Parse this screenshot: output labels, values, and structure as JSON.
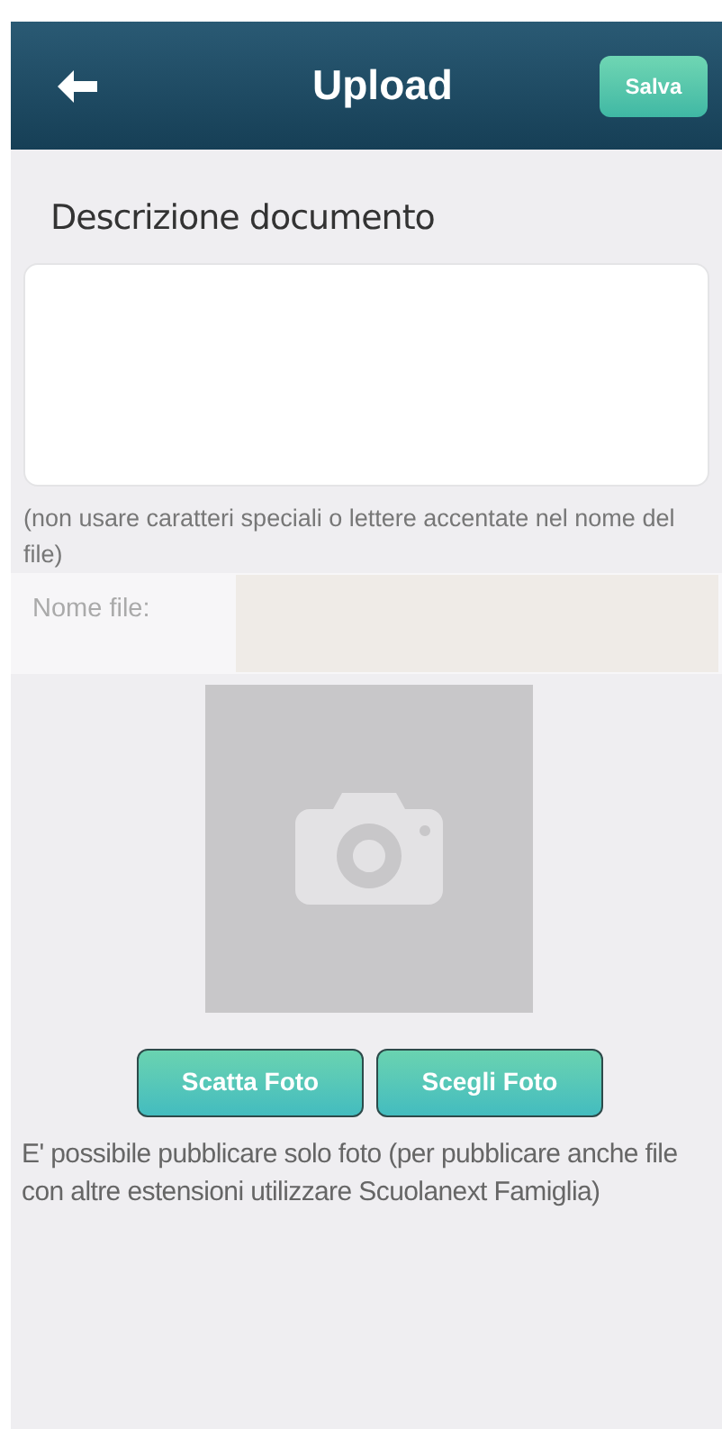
{
  "header": {
    "title": "Upload",
    "save_button": "Salva"
  },
  "description": {
    "label": "Descrizione documento",
    "hint": "(non usare caratteri speciali o lettere accentate nel nome del file)"
  },
  "file_name": {
    "label": "Nome file:"
  },
  "photo_buttons": [
    "Scatta Foto",
    "Scegli Foto"
  ],
  "note": "E' possibile pubblicare solo foto (per pubblicare anche file con altre estensioni utilizzare Scuolanext Famiglia)"
}
